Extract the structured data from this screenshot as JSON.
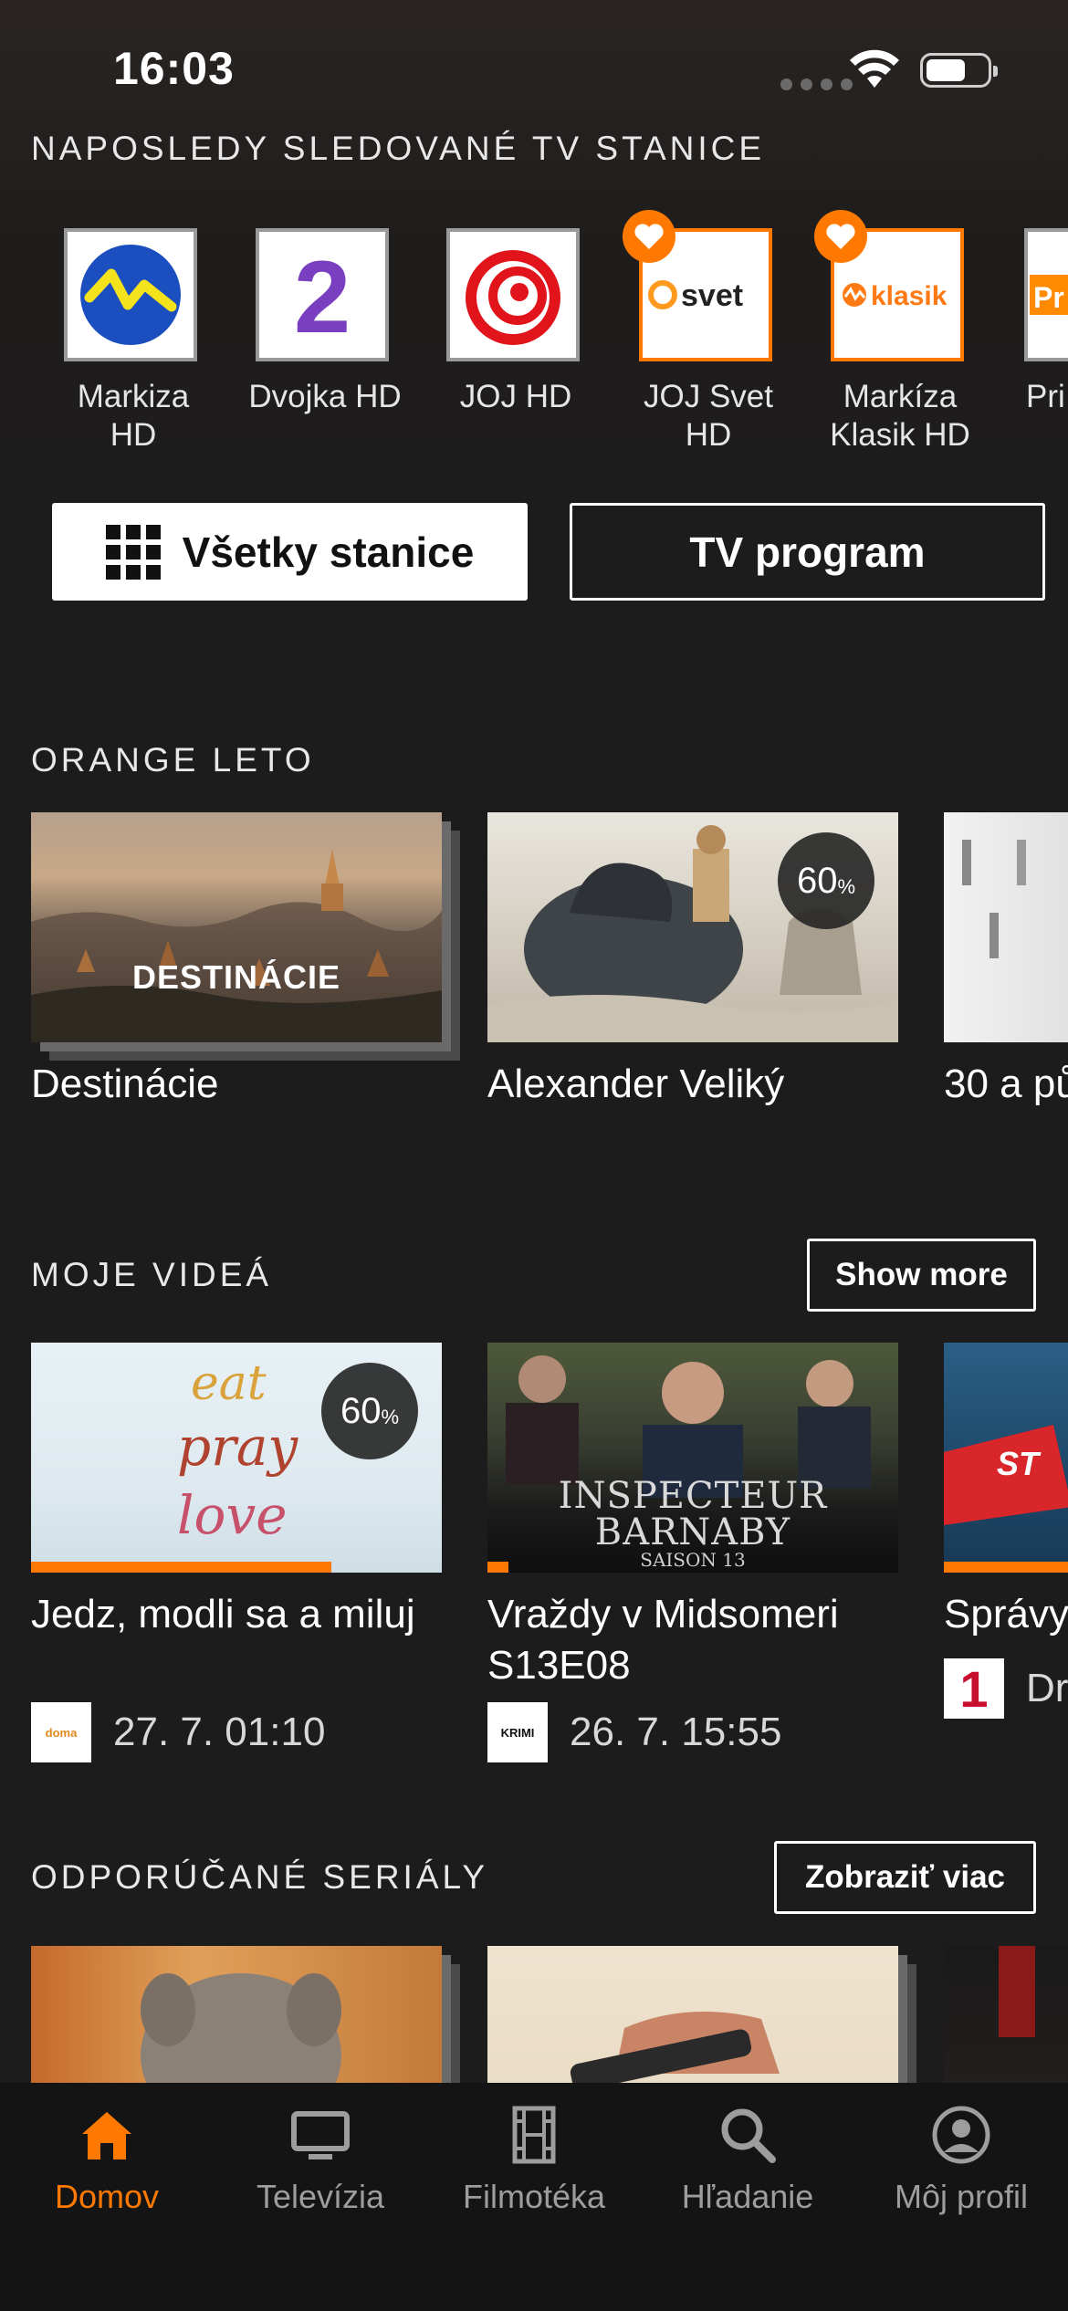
{
  "status_bar": {
    "time": "16:03"
  },
  "recent_stations": {
    "title": "NAPOSLEDY SLEDOVANÉ TV STANICE",
    "items": [
      {
        "name": "Markiza HD",
        "logo": "markiza-logo",
        "favorite": false
      },
      {
        "name": "Dvojka HD",
        "logo": "dvojka-logo",
        "favorite": false
      },
      {
        "name": "JOJ HD",
        "logo": "joj-logo",
        "favorite": false
      },
      {
        "name": "JOJ Svet HD",
        "logo": "joj-svet-logo",
        "logo_text": "svet",
        "favorite": true
      },
      {
        "name": "Markíza Klasik HD",
        "logo": "markiza-klasik-logo",
        "logo_text": "klasik",
        "favorite": true
      },
      {
        "name": "Pri",
        "logo": "prima-logo",
        "logo_text": "Pr",
        "favorite": false
      }
    ],
    "all_stations_button": "Všetky stanice",
    "tv_program_button": "TV program"
  },
  "orange_leto": {
    "title": "ORANGE LETO",
    "items": [
      {
        "title": "Destinácie",
        "overlay_text": "DESTINÁCIE",
        "stacked": true
      },
      {
        "title": "Alexander Veliký",
        "percent": "60",
        "percent_unit": "%"
      },
      {
        "title": "30 a pů"
      }
    ]
  },
  "my_videos": {
    "title": "MOJE VIDEÁ",
    "show_more": "Show more",
    "items": [
      {
        "title": "Jedz, modli sa a miluj",
        "percent": "60",
        "percent_unit": "%",
        "progress": 0.73,
        "channel": "doma",
        "date": "27. 7. 01:10",
        "thumb_text": [
          "eat",
          "pray",
          "love"
        ]
      },
      {
        "title": "Vraždy v Midsomeri S13E08",
        "progress": 0.05,
        "channel": "KRIMI",
        "date": "26. 7. 15:55",
        "thumb_text": [
          "INSPECTEUR",
          "BARNABY",
          "SAISON 13"
        ]
      },
      {
        "title": "Správy",
        "progress": 0.4,
        "channel": "1",
        "date": "Dr",
        "thumb_text": [
          "ST"
        ]
      }
    ]
  },
  "recommended_series": {
    "title": "ODPORÚČANÉ SERIÁLY",
    "show_more": "Zobraziť viac"
  },
  "tabbar": {
    "items": [
      {
        "label": "Domov",
        "active": true
      },
      {
        "label": "Televízia",
        "active": false
      },
      {
        "label": "Filmotéka",
        "active": false
      },
      {
        "label": "Hľadanie",
        "active": false
      },
      {
        "label": "Môj profil",
        "active": false
      }
    ]
  },
  "colors": {
    "accent": "#ff7900",
    "background": "#1c1c1c",
    "tabbar": "#141414"
  }
}
